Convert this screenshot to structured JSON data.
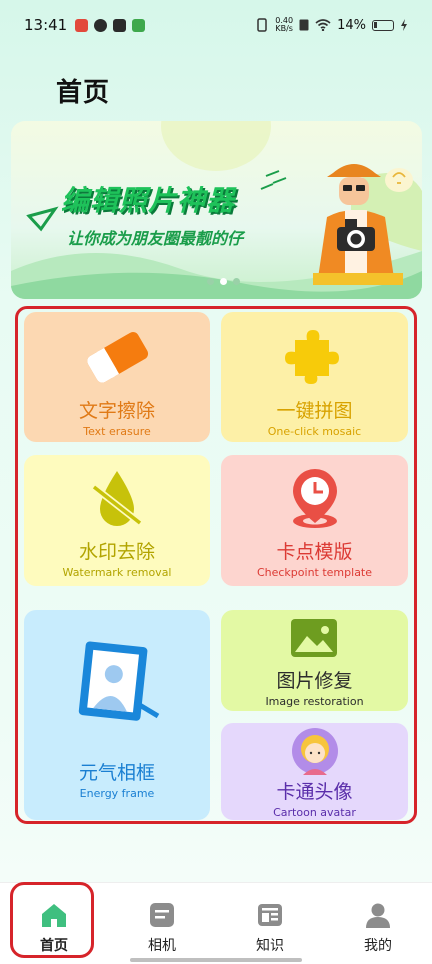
{
  "status_bar": {
    "time": "13:41",
    "speed_value": "0.40",
    "speed_unit": "KB/s",
    "battery": "14%"
  },
  "page": {
    "title": "首页"
  },
  "banner": {
    "title": "编辑照片神器",
    "subtitle": "让你成为朋友圈最靓的仔",
    "slides_total": 3,
    "slide_active": 2
  },
  "features": {
    "text_erase": {
      "label": "文字擦除",
      "label_en": "Text erasure",
      "icon": "eraser-icon"
    },
    "mosaic": {
      "label": "一键拼图",
      "label_en": "One-click mosaic",
      "icon": "puzzle-icon"
    },
    "watermark": {
      "label": "水印去除",
      "label_en": "Watermark removal",
      "icon": "watermark-slash-icon"
    },
    "checkpoint": {
      "label": "卡点模版",
      "label_en": "Checkpoint template",
      "icon": "clock-pin-icon"
    },
    "energy_frame": {
      "label": "元气相框",
      "label_en": "Energy frame",
      "icon": "photo-frame-icon"
    },
    "restore": {
      "label": "图片修复",
      "label_en": "Image restoration",
      "icon": "image-icon"
    },
    "cartoon": {
      "label": "卡通头像",
      "label_en": "Cartoon avatar",
      "icon": "cartoon-avatar-icon"
    }
  },
  "tabs": [
    {
      "label": "首页",
      "icon": "home-icon",
      "active": true
    },
    {
      "label": "相机",
      "icon": "camera-doc-icon",
      "active": false
    },
    {
      "label": "知识",
      "icon": "knowledge-icon",
      "active": false
    },
    {
      "label": "我的",
      "icon": "profile-icon",
      "active": false
    }
  ],
  "colors": {
    "accent_green": "#3fbf7f",
    "highlight_red": "#d6242a",
    "erase_orange": "#e07a16",
    "checkpoint_red": "#dc3a34",
    "energy_blue": "#1a7fd2",
    "cartoon_purple": "#5a2eaa"
  }
}
